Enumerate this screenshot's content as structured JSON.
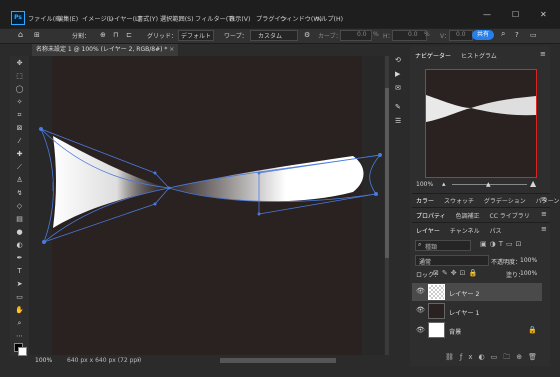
{
  "app": {
    "logo": "Ps"
  },
  "menu": {
    "items": [
      "ファイル(F)",
      "編集(E)",
      "イメージ(I)",
      "レイヤー(L)",
      "書式(Y)",
      "選択範囲(S)",
      "フィルター(T)",
      "表示(V)",
      "プラグイン",
      "ウィンドウ(W)",
      "ヘルプ(H)"
    ]
  },
  "window": {
    "minimize": "—",
    "maximize": "☐",
    "close": "✕"
  },
  "options": {
    "split_label": "分割：",
    "grid_label": "グリッド：",
    "grid_value": "デフォルト",
    "warp_label": "ワープ：",
    "warp_value": "カスタム",
    "curve_label": "カーブ：",
    "curve_value": "0.0",
    "h_label": "H：",
    "h_value": "0.0",
    "v_label": "V：",
    "v_value": "0.0",
    "percent": "%",
    "share_label": "共有"
  },
  "document": {
    "tab_title": "名称未設定 1 @ 100% (レイヤー 2, RGB/8#) *",
    "close": "×"
  },
  "status": {
    "zoom": "100%",
    "info": "640 px x 640 px (72 ppi)",
    "arrow": "›"
  },
  "navigator": {
    "tabs": [
      "ナビゲーター",
      "ヒストグラム"
    ],
    "zoom": "100%"
  },
  "color_panel": {
    "tabs": [
      "カラー",
      "スウォッチ",
      "グラデーション",
      "パターン"
    ]
  },
  "props_panel": {
    "tabs": [
      "プロパティ",
      "色調補正",
      "CC ライブラリ"
    ]
  },
  "layers_panel": {
    "tabs": [
      "レイヤー",
      "チャンネル",
      "パス"
    ],
    "search_placeholder": "種類",
    "blend_mode": "通常",
    "opacity_label": "不透明度：",
    "opacity_value": "100%",
    "lock_label": "ロック：",
    "fill_label": "塗り：",
    "fill_value": "100%",
    "layers": [
      {
        "name": "レイヤー 2",
        "selected": true,
        "thumb": "checker"
      },
      {
        "name": "レイヤー 1",
        "selected": false,
        "thumb": "dark"
      },
      {
        "name": "背景",
        "selected": false,
        "thumb": "white",
        "locked": true
      }
    ]
  },
  "colors": {
    "accent": "#2680eb",
    "selection": "#3a3a3a",
    "warp_line": "#3f6ed4"
  }
}
